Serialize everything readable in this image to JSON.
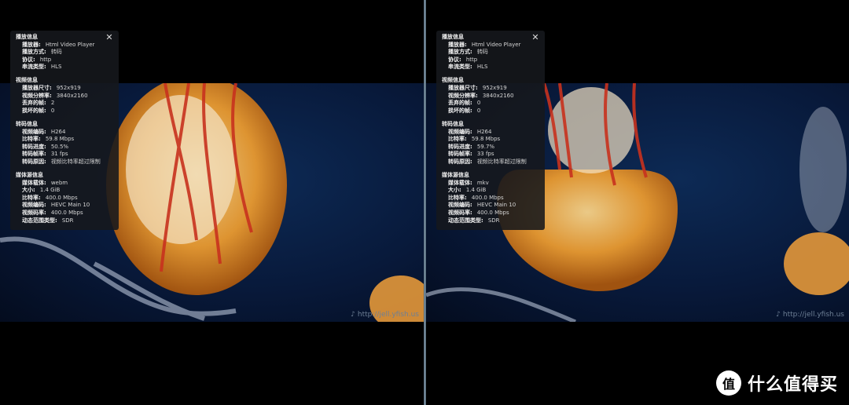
{
  "left": {
    "sections": [
      {
        "title": "播放信息",
        "rows": [
          {
            "k": "播放器:",
            "v": "Html Video Player"
          },
          {
            "k": "播放方式:",
            "v": "转码"
          },
          {
            "k": "协议:",
            "v": "http"
          },
          {
            "k": "串流类型:",
            "v": "HLS"
          }
        ]
      },
      {
        "title": "视频信息",
        "rows": [
          {
            "k": "播放器尺寸:",
            "v": "952x919"
          },
          {
            "k": "视频分辨率:",
            "v": "3840x2160"
          },
          {
            "k": "丢弃的帧:",
            "v": "2"
          },
          {
            "k": "损坏的帧:",
            "v": "0"
          }
        ]
      },
      {
        "title": "转码信息",
        "rows": [
          {
            "k": "视频编码:",
            "v": "H264"
          },
          {
            "k": "比特率:",
            "v": "59.8 Mbps"
          },
          {
            "k": "转码进度:",
            "v": "50.5%"
          },
          {
            "k": "转码帧率:",
            "v": "31 fps"
          },
          {
            "k": "转码原因:",
            "v": "视频比特率超过限制"
          }
        ]
      },
      {
        "title": "媒体源信息",
        "rows": [
          {
            "k": "媒体载体:",
            "v": "webm"
          },
          {
            "k": "大小:",
            "v": "1.4 GiB"
          },
          {
            "k": "比特率:",
            "v": "400.0 Mbps"
          },
          {
            "k": "视频编码:",
            "v": "HEVC Main 10"
          },
          {
            "k": "视频码率:",
            "v": "400.0 Mbps"
          },
          {
            "k": "动态范围类型:",
            "v": "SDR"
          }
        ]
      }
    ],
    "watermark": "http://jell.yfish.us"
  },
  "right": {
    "sections": [
      {
        "title": "播放信息",
        "rows": [
          {
            "k": "播放器:",
            "v": "Html Video Player"
          },
          {
            "k": "播放方式:",
            "v": "转码"
          },
          {
            "k": "协议:",
            "v": "http"
          },
          {
            "k": "串流类型:",
            "v": "HLS"
          }
        ]
      },
      {
        "title": "视频信息",
        "rows": [
          {
            "k": "播放器尺寸:",
            "v": "952x919"
          },
          {
            "k": "视频分辨率:",
            "v": "3840x2160"
          },
          {
            "k": "丢弃的帧:",
            "v": "0"
          },
          {
            "k": "损坏的帧:",
            "v": "0"
          }
        ]
      },
      {
        "title": "转码信息",
        "rows": [
          {
            "k": "视频编码:",
            "v": "H264"
          },
          {
            "k": "比特率:",
            "v": "59.8 Mbps"
          },
          {
            "k": "转码进度:",
            "v": "59.7%"
          },
          {
            "k": "转码帧率:",
            "v": "33 fps"
          },
          {
            "k": "转码原因:",
            "v": "视频比特率超过限制"
          }
        ]
      },
      {
        "title": "媒体源信息",
        "rows": [
          {
            "k": "媒体载体:",
            "v": "mkv"
          },
          {
            "k": "大小:",
            "v": "1.4 GiB"
          },
          {
            "k": "比特率:",
            "v": "400.0 Mbps"
          },
          {
            "k": "视频编码:",
            "v": "HEVC Main 10"
          },
          {
            "k": "视频码率:",
            "v": "400.0 Mbps"
          },
          {
            "k": "动态范围类型:",
            "v": "SDR"
          }
        ]
      }
    ],
    "watermark": "http://jell.yfish.us"
  },
  "brand": {
    "badge": "值",
    "name": "什么值得买"
  },
  "colors": {
    "jelly": "#e8962e",
    "tentacle": "#c8321e",
    "water": "#0d2a55"
  }
}
